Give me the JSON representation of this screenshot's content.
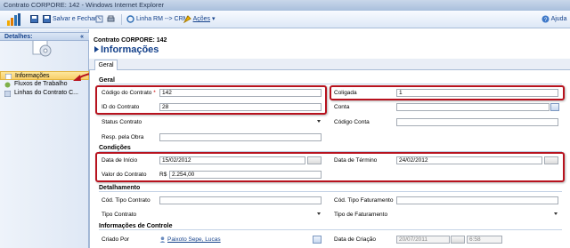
{
  "window": {
    "title": "Contrato CORPORE: 142 - Windows Internet Explorer"
  },
  "toolbar": {
    "save_close": "Salvar e Fechar",
    "link_rm": "Linha RM --> CRM",
    "acoes": "Ações",
    "ajuda": "Ajuda"
  },
  "nav": {
    "header": "Detalhes:",
    "items": [
      "Informações",
      "Fluxos de Trabalho",
      "Linhas do Contrato C..."
    ]
  },
  "header": {
    "line1": "Contrato CORPORE: 142",
    "title": "Informações"
  },
  "tabs": {
    "geral": "Geral"
  },
  "sections": {
    "geral": "Geral",
    "condicoes": "Condições",
    "detalhamento": "Detalhamento",
    "controle": "Informações de Controle"
  },
  "fields": {
    "codigo_contrato": {
      "label": "Código do Contrato",
      "value": "142"
    },
    "id_contrato": {
      "label": "ID do Contrato",
      "value": "28"
    },
    "status_contrato": {
      "label": "Status Contrato",
      "value": ""
    },
    "resp_obra": {
      "label": "Resp. pela Obra",
      "value": ""
    },
    "coligada": {
      "label": "Coligada",
      "value": "1"
    },
    "conta": {
      "label": "Conta",
      "value": ""
    },
    "codigo_conta": {
      "label": "Código Conta",
      "value": ""
    },
    "data_inicio": {
      "label": "Data de Início",
      "value": "15/02/2012"
    },
    "data_termino": {
      "label": "Data de Término",
      "value": "24/02/2012"
    },
    "valor_contrato": {
      "label": "Valor do Contrato",
      "currency": "R$",
      "value": "2.254,00"
    },
    "cod_tipo_contrato": {
      "label": "Cód. Tipo Contrato",
      "value": ""
    },
    "tipo_contrato": {
      "label": "Tipo Contrato",
      "value": ""
    },
    "cod_tipo_faturamento": {
      "label": "Cód. Tipo Faturamento",
      "value": ""
    },
    "tipo_faturamento": {
      "label": "Tipo de Faturamento",
      "value": ""
    },
    "criado_por": {
      "label": "Criado Por",
      "value": "Paixoto Sepe, Lucas"
    },
    "data_criacao": {
      "label": "Data de Criação",
      "value": "20/07/2011",
      "time": "6:58"
    }
  },
  "colors": {
    "accent": "#15428b",
    "highlight": "#b7121e"
  }
}
